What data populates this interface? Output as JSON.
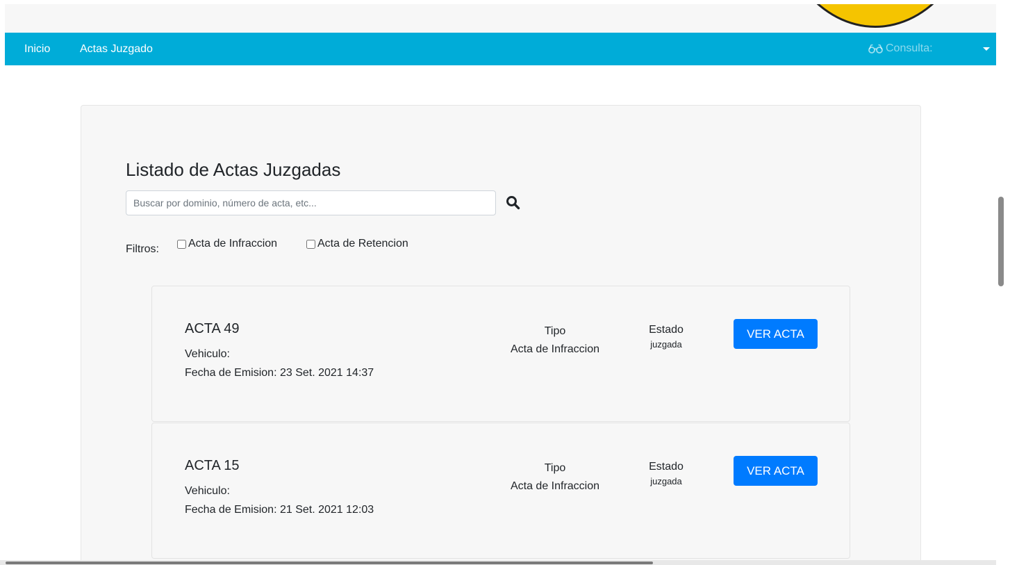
{
  "navbar": {
    "links": [
      "Inicio",
      "Actas Juzgado"
    ],
    "consulta_label": "Consulta:",
    "consulta_icon": "glasses-icon",
    "dropdown_icon": "caret-down-icon",
    "bg_color": "#00acd8"
  },
  "main": {
    "title": "Listado de Actas Juzgadas",
    "search": {
      "placeholder": "Buscar por dominio, número de acta, etc...",
      "value": "",
      "icon": "search-icon"
    },
    "filters": {
      "label": "Filtros:",
      "options": [
        {
          "label": "Acta de Infraccion",
          "checked": false
        },
        {
          "label": "Acta de Retencion",
          "checked": false
        }
      ]
    },
    "actas": [
      {
        "title": "ACTA 49",
        "vehiculo": "Vehiculo:",
        "fecha": "Fecha de Emision: 23 Set. 2021 14:37",
        "tipo_label": "Tipo",
        "tipo_value": "Acta de Infraccion",
        "estado_label": "Estado",
        "estado_value": "juzgada",
        "button_label": "VER ACTA"
      },
      {
        "title": "ACTA 15",
        "vehiculo": "Vehiculo:",
        "fecha": "Fecha de Emision: 21 Set. 2021 12:03",
        "tipo_label": "Tipo",
        "tipo_value": "Acta de Infraccion",
        "estado_label": "Estado",
        "estado_value": "juzgada",
        "button_label": "VER ACTA"
      }
    ]
  },
  "colors": {
    "primary_button": "#007bff",
    "card_bg": "#f7f7f7",
    "logo_yellow": "#f5c400"
  }
}
